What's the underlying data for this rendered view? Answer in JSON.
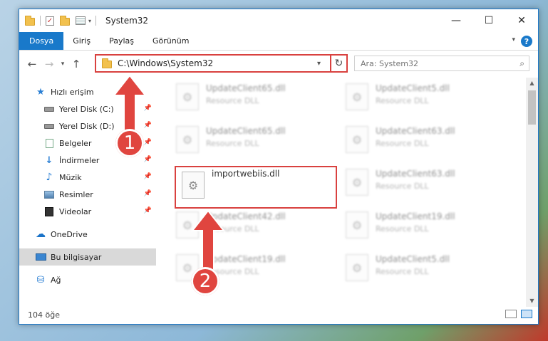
{
  "window": {
    "title": "System32"
  },
  "ribbon": {
    "tabs": [
      {
        "label": "Dosya"
      },
      {
        "label": "Giriş"
      },
      {
        "label": "Paylaş"
      },
      {
        "label": "Görünüm"
      }
    ],
    "help": "?"
  },
  "address": {
    "path": "C:\\Windows\\System32"
  },
  "search": {
    "placeholder": "Ara: System32"
  },
  "sidebar": {
    "quick_access": "Hızlı erişim",
    "items": [
      {
        "label": "Yerel Disk (C:)"
      },
      {
        "label": "Yerel Disk (D:)"
      },
      {
        "label": "Belgeler"
      },
      {
        "label": "İndirmeler"
      },
      {
        "label": "Müzik"
      },
      {
        "label": "Resimler"
      },
      {
        "label": "Videolar"
      }
    ],
    "onedrive": "OneDrive",
    "this_pc": "Bu bilgisayar",
    "network": "Ağ"
  },
  "files": [
    {
      "name": "UpdateClient65.dll",
      "type": "Resource DLL"
    },
    {
      "name": "UpdateClient5.dll",
      "type": "Resource DLL"
    },
    {
      "name": "UpdateClient65.dll",
      "type": "Resource DLL"
    },
    {
      "name": "UpdateClient63.dll",
      "type": "Resource DLL"
    },
    {
      "name": "importwebiis.dll",
      "type": ""
    },
    {
      "name": "UpdateClient63.dll",
      "type": "Resource DLL"
    },
    {
      "name": "UpdateClient42.dll",
      "type": "Resource DLL"
    },
    {
      "name": "UpdateClient19.dll",
      "type": "Resource DLL"
    },
    {
      "name": "UpdateClient19.dll",
      "type": "Resource DLL"
    },
    {
      "name": "UpdateClient5.dll",
      "type": "Resource DLL"
    }
  ],
  "status": {
    "count": "104 öğe"
  },
  "annotations": {
    "step1": "1",
    "step2": "2",
    "color": "#e0453f"
  }
}
